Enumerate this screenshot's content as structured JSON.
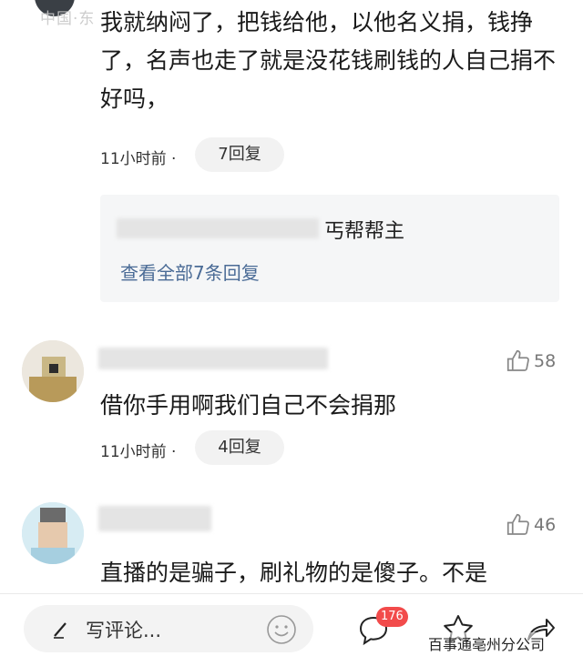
{
  "top_watermark": "中国·东",
  "comments": [
    {
      "text": "我就纳闷了，把钱给他，以他名义捐，钱挣了，名声也走了就是没花钱刷钱的人自己捐不好吗，",
      "time": "11小时前 ·",
      "reply_count": "7回复",
      "reply_preview": {
        "author_suffix": "丐帮帮主",
        "view_all": "查看全部7条回复"
      }
    },
    {
      "likes": "58",
      "text": "借你手用啊我们自己不会捐那",
      "time": "11小时前 ·",
      "reply_count": "4回复"
    },
    {
      "likes": "46",
      "text": "直播的是骗子，刷礼物的是傻子。不是"
    }
  ],
  "bottom_bar": {
    "comment_placeholder": "写评论...",
    "comment_badge": "176",
    "watermark": "百事通亳州分公司"
  },
  "colors": {
    "accent_link": "#4a6b96",
    "badge": "#f24b4b"
  }
}
